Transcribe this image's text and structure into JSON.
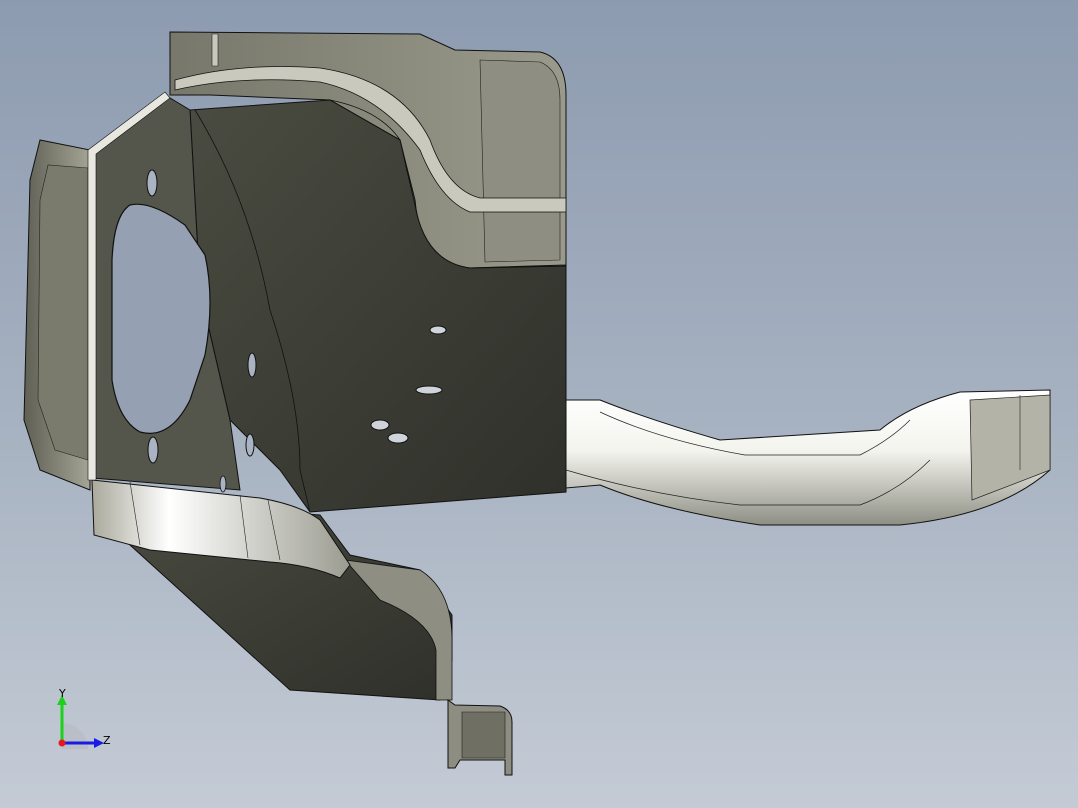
{
  "viewport": {
    "background_top": "#8d9bb0",
    "background_bottom": "#c4cbd5"
  },
  "model": {
    "face_dark": "#3b3d34",
    "face_mid": "#6e6f62",
    "face_light": "#d6d6cc",
    "edge_color": "#111111"
  },
  "triad": {
    "y_label": "Y",
    "z_label": "Z",
    "y_color": "#1bd11b",
    "z_color": "#1a1ae6",
    "x_color": "#e61a1a"
  }
}
